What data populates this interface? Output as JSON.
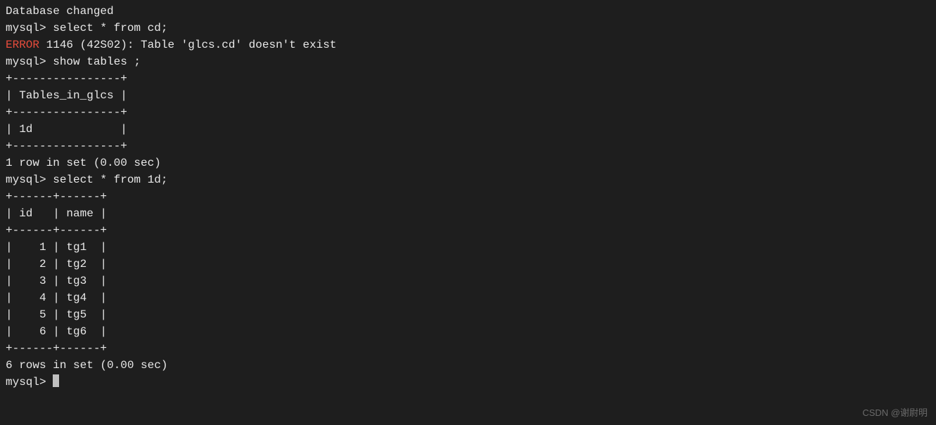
{
  "lines": {
    "db_changed": "Database changed",
    "prompt1": "mysql> select * from cd;",
    "error_label": "ERROR",
    "error_rest": " 1146 (42S02): Table 'glcs.cd' doesn't exist",
    "prompt2": "mysql> show tables ;",
    "tbl1_sep": "+----------------+",
    "tbl1_header": "| Tables_in_glcs |",
    "tbl1_row": "| 1d             |",
    "tbl1_result": "1 row in set (0.00 sec)",
    "blank": "",
    "prompt3": "mysql> select * from 1d;",
    "tbl2_sep": "+------+------+",
    "tbl2_header": "| id   | name |",
    "tbl2_r1": "|    1 | tg1  |",
    "tbl2_r2": "|    2 | tg2  |",
    "tbl2_r3": "|    3 | tg3  |",
    "tbl2_r4": "|    4 | tg4  |",
    "tbl2_r5": "|    5 | tg5  |",
    "tbl2_r6": "|    6 | tg6  |",
    "tbl2_result": "6 rows in set (0.00 sec)",
    "prompt4_prefix": "mysql> "
  },
  "watermark": "CSDN @谢尉明"
}
